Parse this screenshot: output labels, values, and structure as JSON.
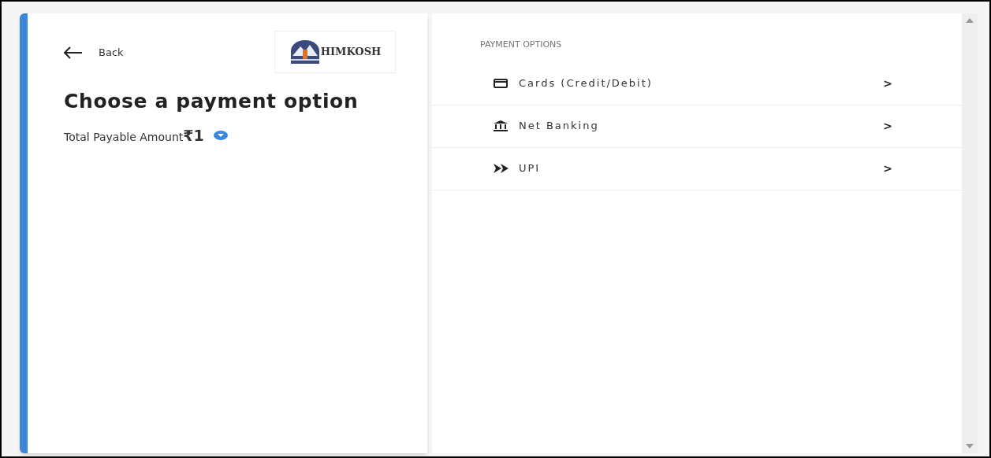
{
  "back": {
    "label": "Back"
  },
  "logo": {
    "text": "HIMKOSH"
  },
  "title": "Choose a payment option",
  "amount": {
    "label": "Total Payable Amount",
    "value": "₹1"
  },
  "options_heading": "PAYMENT OPTIONS",
  "options": [
    {
      "kind": "card",
      "label": "Cards (Credit/Debit)",
      "arrow": ">"
    },
    {
      "kind": "bank",
      "label": "Net Banking",
      "arrow": ">"
    },
    {
      "kind": "upi",
      "label": "UPI",
      "arrow": ">"
    }
  ]
}
